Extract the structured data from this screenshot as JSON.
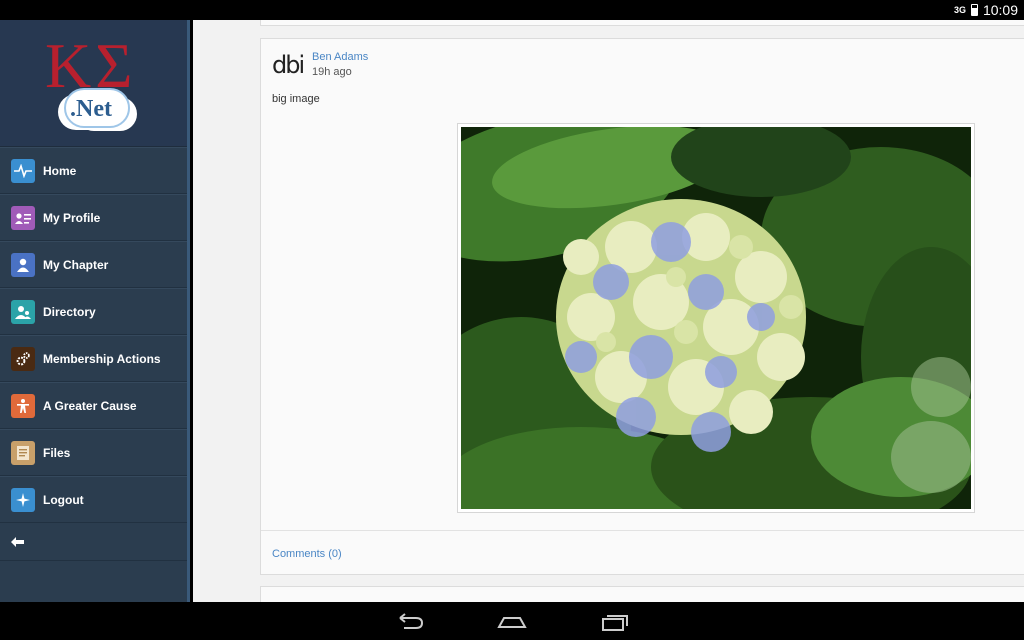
{
  "status_bar": {
    "signal": "3G",
    "time": "10:09"
  },
  "sidebar": {
    "logo": {
      "greek": "ΚΣ",
      "net": ".Net"
    },
    "items": [
      {
        "label": "Home",
        "icon": "pulse-icon",
        "color": "#3a8fd0"
      },
      {
        "label": "My Profile",
        "icon": "profile-card-icon",
        "color": "#a05bb8"
      },
      {
        "label": "My Chapter",
        "icon": "person-icon",
        "color": "#4a72c4"
      },
      {
        "label": "Directory",
        "icon": "people-icon",
        "color": "#2ba3a8"
      },
      {
        "label": "Membership Actions",
        "icon": "gears-icon",
        "color": "#4a2a12"
      },
      {
        "label": "A Greater Cause",
        "icon": "figure-icon",
        "color": "#e06a3a"
      },
      {
        "label": "Files",
        "icon": "document-icon",
        "color": "#c8a06a"
      },
      {
        "label": "Logout",
        "icon": "compass-icon",
        "color": "#3a8fd0"
      }
    ],
    "back_icon": "arrow-left-icon"
  },
  "post": {
    "avatar_text": "dbi",
    "author": "Ben Adams",
    "time": "19h ago",
    "text": "big image",
    "image": "hydrangea-photo",
    "comments_label": "Comments (0)"
  },
  "colors": {
    "sidebar_bg": "#2b3d4f",
    "link": "#4a86c5",
    "logo_red": "#b8202e"
  }
}
